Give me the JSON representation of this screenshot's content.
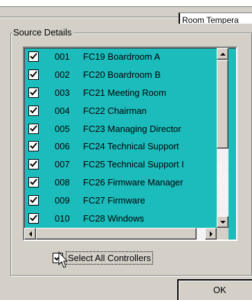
{
  "background_field_text": "Room Tempera",
  "source_group": {
    "title": "Source Details"
  },
  "controllers": [
    {
      "num": "001",
      "name": "FC19 Boardroom A",
      "checked": true
    },
    {
      "num": "002",
      "name": "FC20 Boardroom B",
      "checked": true
    },
    {
      "num": "003",
      "name": "FC21 Meeting Room",
      "checked": true
    },
    {
      "num": "004",
      "name": "FC22 Chairman",
      "checked": true
    },
    {
      "num": "005",
      "name": "FC23 Managing Director",
      "checked": true
    },
    {
      "num": "006",
      "name": "FC24 Technical Support",
      "checked": true
    },
    {
      "num": "007",
      "name": "FC25 Technical Support I",
      "checked": true
    },
    {
      "num": "008",
      "name": "FC26 Firmware Manager",
      "checked": true
    },
    {
      "num": "009",
      "name": "FC27 Firmware",
      "checked": true
    },
    {
      "num": "010",
      "name": "FC28 Windows",
      "checked": true
    }
  ],
  "select_all": {
    "label": "Select All Controllers",
    "checked": true
  },
  "ok_button": {
    "label": "OK"
  },
  "colors": {
    "list_bg": "#1cbcbc",
    "dialog_bg": "#d4d0c8"
  },
  "icons": [
    "checkmark-icon",
    "scroll-up-arrow",
    "scroll-down-arrow",
    "scroll-left-arrow",
    "scroll-right-arrow",
    "mouse-pointer-icon"
  ]
}
